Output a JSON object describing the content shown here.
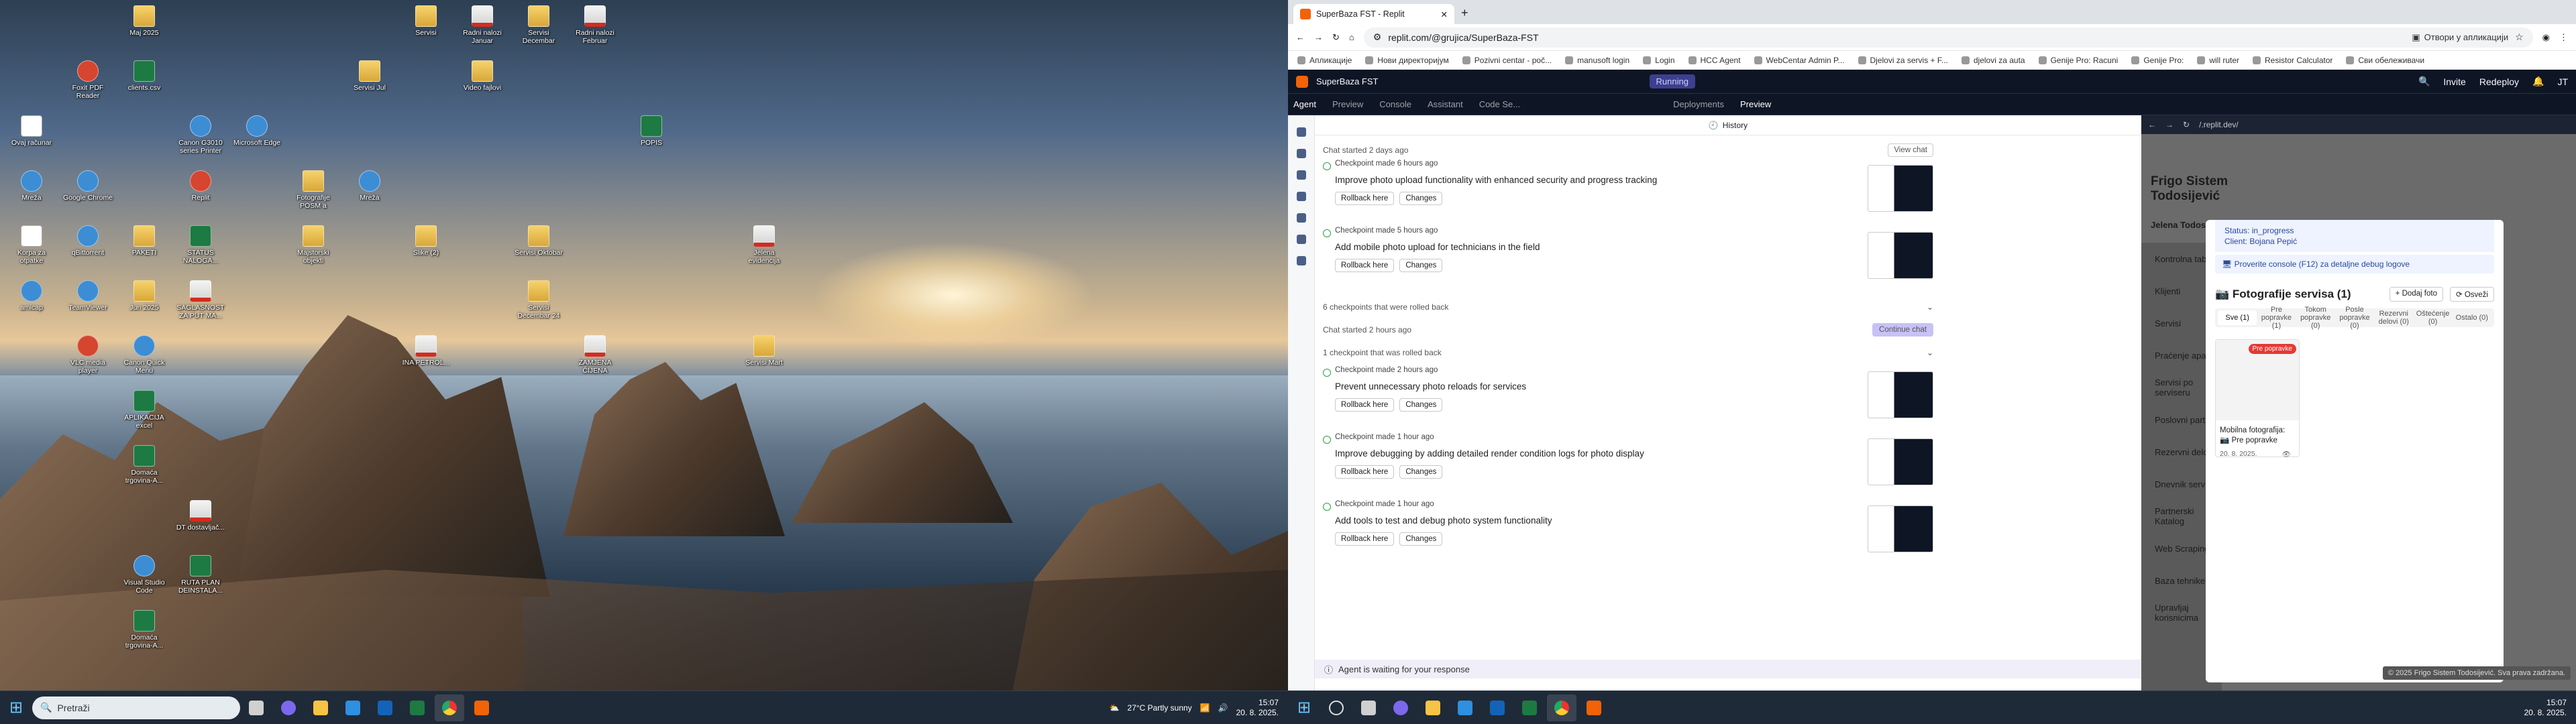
{
  "desktop": {
    "icons": [
      {
        "label": "Ovaj računar",
        "type": "lnk",
        "col": 0,
        "row": 2
      },
      {
        "label": "Mreža",
        "type": "app",
        "col": 0,
        "row": 3
      },
      {
        "label": "Korpa za otpatke",
        "type": "lnk",
        "col": 0,
        "row": 4
      },
      {
        "label": "amicap",
        "type": "app",
        "col": 0,
        "row": 5
      },
      {
        "label": "Foxit PDF Reader",
        "type": "app2",
        "col": 1,
        "row": 1
      },
      {
        "label": "Google Chrome",
        "type": "app",
        "col": 1,
        "row": 3
      },
      {
        "label": "qBittorrent",
        "type": "app",
        "col": 1,
        "row": 4
      },
      {
        "label": "TeamViewer",
        "type": "app",
        "col": 1,
        "row": 5
      },
      {
        "label": "VLC media player",
        "type": "app2",
        "col": 1,
        "row": 6
      },
      {
        "label": "Maj 2025",
        "type": "folder",
        "col": 2,
        "row": 0
      },
      {
        "label": "clients.csv",
        "type": "xls",
        "col": 2,
        "row": 1
      },
      {
        "label": "PAKETI",
        "type": "folder",
        "col": 2,
        "row": 4
      },
      {
        "label": "Jun 2025",
        "type": "folder",
        "col": 2,
        "row": 5
      },
      {
        "label": "Canon Quick Menu",
        "type": "app",
        "col": 2,
        "row": 6
      },
      {
        "label": "APLIKACIJA excel",
        "type": "xls",
        "col": 2,
        "row": 7
      },
      {
        "label": "Domaća trgovina-A...",
        "type": "xls",
        "col": 2,
        "row": 8
      },
      {
        "label": "Visual Studio Code",
        "type": "app",
        "col": 2,
        "row": 10
      },
      {
        "label": "Domaća trgovina-A...",
        "type": "xls",
        "col": 2,
        "row": 11
      },
      {
        "label": "Canon G3010 series Printer",
        "type": "app",
        "col": 3,
        "row": 2
      },
      {
        "label": "Replit",
        "type": "app2",
        "col": 3,
        "row": 3
      },
      {
        "label": "STATUS NALOGA...",
        "type": "xls",
        "col": 3,
        "row": 4
      },
      {
        "label": "SAGLASNOST ZA PUT MA...",
        "type": "pdf",
        "col": 3,
        "row": 5
      },
      {
        "label": "DT dostavljač...",
        "type": "pdf",
        "col": 3,
        "row": 9
      },
      {
        "label": "RUTA PLAN DEINSTALA...",
        "type": "xls",
        "col": 3,
        "row": 10
      },
      {
        "label": "Microsoft Edge",
        "type": "app",
        "col": 4,
        "row": 2
      },
      {
        "label": "Fotografije POSM a",
        "type": "folder",
        "col": 5,
        "row": 3
      },
      {
        "label": "Majstorski objekti",
        "type": "folder",
        "col": 5,
        "row": 4
      },
      {
        "label": "Servisi Jul",
        "type": "folder",
        "col": 6,
        "row": 1
      },
      {
        "label": "Mreža",
        "type": "app",
        "col": 6,
        "row": 3
      },
      {
        "label": "Servisi",
        "type": "folder",
        "col": 7,
        "row": 0
      },
      {
        "label": "Slike (2)",
        "type": "folder",
        "col": 7,
        "row": 4
      },
      {
        "label": "INA PETROL...",
        "type": "pdf",
        "col": 7,
        "row": 6
      },
      {
        "label": "Radni nalozi Januar",
        "type": "pdf",
        "col": 8,
        "row": 0
      },
      {
        "label": "Video fajlovi",
        "type": "folder",
        "col": 8,
        "row": 1
      },
      {
        "label": "Servisi Decembar",
        "type": "folder",
        "col": 9,
        "row": 0
      },
      {
        "label": "Servisi Oktobar",
        "type": "folder",
        "col": 9,
        "row": 4
      },
      {
        "label": "Servisi Decembar 24",
        "type": "folder",
        "col": 9,
        "row": 5
      },
      {
        "label": "Radni nalozi Februar",
        "type": "pdf",
        "col": 10,
        "row": 0
      },
      {
        "label": "ZAMJENA ČIJENA",
        "type": "pdf",
        "col": 10,
        "row": 6
      },
      {
        "label": "POPIS",
        "type": "xls",
        "col": 11,
        "row": 2
      },
      {
        "label": "Jelena evidencija",
        "type": "pdf",
        "col": 13,
        "row": 4
      },
      {
        "label": "Servisi Mart",
        "type": "folder",
        "col": 13,
        "row": 6
      }
    ]
  },
  "taskbar_left": {
    "search_placeholder": "Pretraži",
    "weather": "27°C  Partly sunny",
    "time": "15:07",
    "date": "20. 8. 2025."
  },
  "taskbar_right": {
    "time": "15:07",
    "date": "20. 8. 2025."
  },
  "browser": {
    "tab_title": "SuperBaza FST - Replit",
    "url": "replit.com/@grujica/SuperBaza-FST",
    "open_in_app": "Отвори у апликацији",
    "bookmarks": [
      "Апликације",
      "Нови директоријум",
      "Pozivni centar - poč...",
      "manusoft login",
      "Login",
      "HCC Agent",
      "WebCentar Admin P...",
      "Djelovi za servis + F...",
      "djelovi za auta",
      "Genije Pro: Racuni",
      "Genije Pro:",
      "will ruter",
      "Resistor Calculator",
      "Сви обележивачи"
    ]
  },
  "replit": {
    "project": "SuperBaza FST",
    "status": "Running",
    "invite": "Invite",
    "redeploy": "Redeploy",
    "tabs": [
      "Agent",
      "Preview",
      "Console",
      "Assistant",
      "Code Se..."
    ],
    "right_tabs": [
      "Deployments",
      "Preview"
    ],
    "history": "History",
    "chat1": "Chat started 2 days ago",
    "view_chat": "View chat",
    "chat2": "Chat started 2 hours ago",
    "continue_chat": "Continue chat",
    "rollback": "Rollback here",
    "changes": "Changes",
    "rolled1": "6 checkpoints that were rolled back",
    "rolled2": "1 checkpoint that was rolled back",
    "checkpoints_a": [
      {
        "when": "Checkpoint made 6 hours ago",
        "title": "Improve photo upload functionality with enhanced security and progress tracking"
      },
      {
        "when": "Checkpoint made 5 hours ago",
        "title": "Add mobile photo upload for technicians in the field"
      }
    ],
    "checkpoints_b": [
      {
        "when": "Checkpoint made 2 hours ago",
        "title": "Prevent unnecessary photo reloads for services"
      },
      {
        "when": "Checkpoint made 1 hour ago",
        "title": "Improve debugging by adding detailed render condition logs for photo display"
      },
      {
        "when": "Checkpoint made 1 hour ago",
        "title": "Add tools to test and debug photo system functionality"
      }
    ],
    "waiting": "Agent is waiting for your response",
    "preview_url": "/.replit.dev/"
  },
  "app": {
    "company": "Frigo Sistem Todosijević",
    "user": "Jelena Todosijević",
    "sidebar": [
      "Kontrolna tabla",
      "Klijenti",
      "Servisi",
      "Praćenje aparata",
      "Servisi po serviseru",
      "Poslovni partneri",
      "Rezervni delovi",
      "Dnevnik servisa",
      "Partnerski Katalog",
      "Web Scraping",
      "Baza tehnike",
      "Upravljaj korisnicima"
    ],
    "status_line": "Status: in_progress",
    "client_line": "Client: Bojana Pepić",
    "console_hint": "Proverite console (F12) za detaljne debug logove",
    "photos_title": "Fotografije servisa (1)",
    "add_photo": "Dodaj foto",
    "refresh": "Osveži",
    "filters": [
      "Sve (1)",
      "Pre popravke (1)",
      "Tokom popravke (0)",
      "Posle popravke (0)",
      "Rezervni delovi (0)",
      "Oštećenje (0)",
      "Ostalo (0)"
    ],
    "card_badge": "Pre popravke",
    "card_caption": "Mobilna fotografija: 📷 Pre popravke",
    "card_date": "20. 8. 2025.",
    "footer": "© 2025 Frigo Sistem Todosijević. Sva prava zadržana."
  }
}
